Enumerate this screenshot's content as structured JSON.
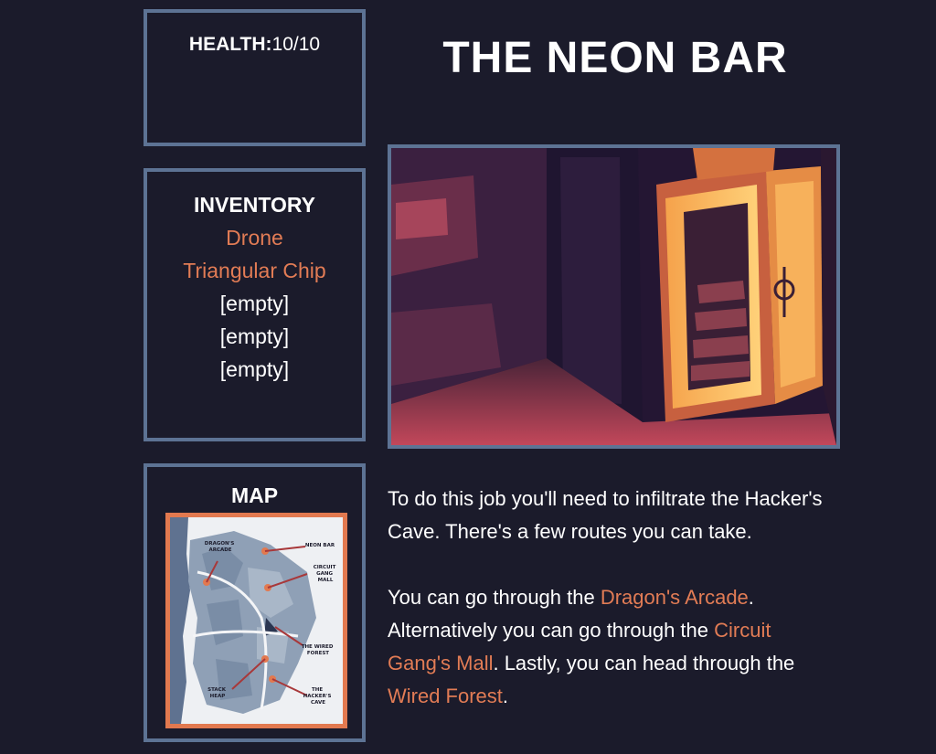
{
  "health": {
    "label": "HEALTH:",
    "value": "10/10"
  },
  "inventory": {
    "title": "INVENTORY",
    "items": [
      "Drone",
      "Triangular Chip",
      "[empty]",
      "[empty]",
      "[empty]"
    ]
  },
  "map": {
    "title": "MAP",
    "labels": {
      "dragons_arcade": [
        "DRAGON'S",
        "ARCADE"
      ],
      "neon_bar": "NEON BAR",
      "circuit_gang_mall": [
        "CIRCUIT",
        "GANG",
        "MALL"
      ],
      "wired_forest": [
        "THE WIRED",
        "FOREST"
      ],
      "stack_heap": [
        "STACK",
        "HEAP"
      ],
      "hackers_cave": [
        "THE",
        "HACKER'S",
        "CAVE"
      ]
    }
  },
  "location": {
    "title": "THE NEON BAR"
  },
  "narrative": {
    "p1": "To do this job you'll need to infiltrate the Hacker's Cave. There's a few routes you can take.",
    "p2_before": "You can go through the ",
    "link_dragons_arcade": "Dragon's Arcade",
    "p2_mid1": ". Alternatively you can go through the ",
    "link_circuit_gang_mall": "Circuit Gang's Mall",
    "p2_mid2": ". Lastly, you can head through the ",
    "link_wired_forest": "Wired Forest",
    "p2_end": "."
  },
  "colors": {
    "background": "#1b1b2b",
    "panel_border": "#5d7394",
    "accent": "#e27c55"
  }
}
